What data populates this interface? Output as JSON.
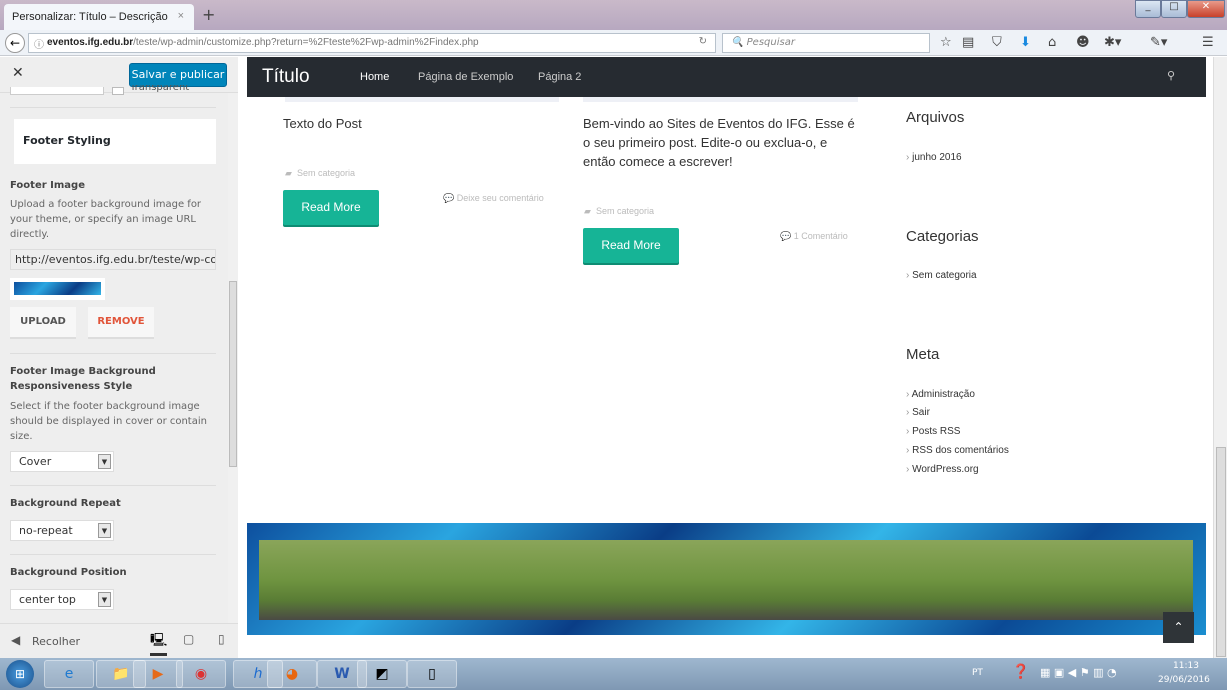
{
  "browser": {
    "tab_title": "Personalizar: Título – Descrição",
    "url_host": "eventos.ifg.edu.br",
    "url_path": "/teste/wp-admin/customize.php?return=%2Fteste%2Fwp-admin%2Findex.php",
    "search_placeholder": "Pesquisar"
  },
  "customizer": {
    "publish_label": "Salvar e publicar",
    "transparent_label": "Transparent",
    "section_title": "Footer Styling",
    "footer_image": {
      "label": "Footer Image",
      "description": "Upload a footer background image for your theme, or specify an image URL directly.",
      "url": "http://eventos.ifg.edu.br/teste/wp-cor",
      "upload": "UPLOAD",
      "remove": "REMOVE"
    },
    "responsive": {
      "label": "Footer Image Background Responsiveness Style",
      "description": "Select if the footer background image should be displayed in cover or contain size.",
      "value": "Cover"
    },
    "repeat": {
      "label": "Background Repeat",
      "value": "no-repeat"
    },
    "position": {
      "label": "Background Position",
      "value": "center top"
    },
    "collapse": "Recolher"
  },
  "site": {
    "title": "Título",
    "nav": [
      "Home",
      "Página de Exemplo",
      "Página 2"
    ],
    "posts": [
      {
        "excerpt": "Texto do Post",
        "category": "Sem categoria",
        "comments": "Deixe seu comentário",
        "read_more": "Read More"
      },
      {
        "excerpt": "Bem-vindo ao Sites de Eventos do IFG. Esse é o seu primeiro post. Edite-o ou exclua-o, e então comece a escrever!",
        "category": "Sem categoria",
        "comments": "1 Comentário",
        "read_more": "Read More"
      }
    ],
    "widgets": {
      "archives": {
        "title": "Arquivos",
        "items": [
          "junho 2016"
        ]
      },
      "categories": {
        "title": "Categorias",
        "items": [
          "Sem categoria"
        ]
      },
      "meta": {
        "title": "Meta",
        "items": [
          "Administração",
          "Sair",
          "Posts RSS",
          "RSS dos comentários",
          "WordPress.org"
        ]
      }
    }
  },
  "taskbar": {
    "lang": "PT",
    "time": "11:13",
    "date": "29/06/2016"
  },
  "colors": {
    "accent": "#16b496",
    "publish": "#0085ba",
    "header": "#262b31",
    "remove": "#e1553a"
  }
}
